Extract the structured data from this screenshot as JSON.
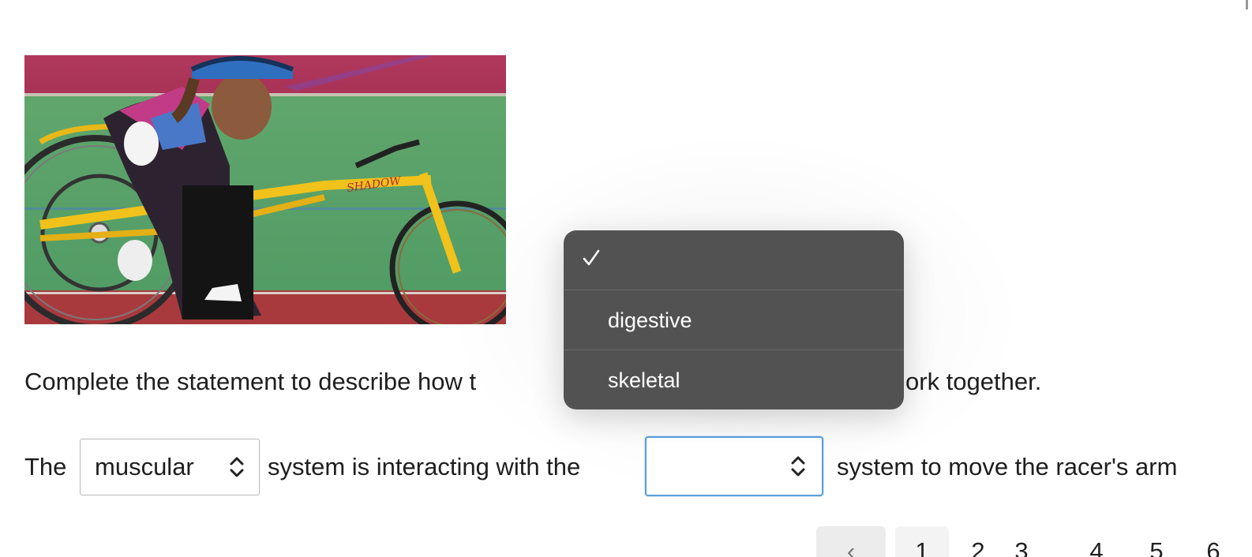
{
  "question": {
    "prompt_start": "Complete the statement to describe how t",
    "prompt_end": "ork together.",
    "statement": {
      "word_the": "The",
      "middle": "system is interacting with the",
      "end": "system to move the racer's arm"
    }
  },
  "select_1": {
    "value": "muscular",
    "icon": "up-down-chevron-icon"
  },
  "select_2": {
    "value": "",
    "icon": "up-down-chevron-icon",
    "focused": true
  },
  "dropdown": {
    "options": [
      {
        "label": "",
        "checked": true
      },
      {
        "label": "digestive",
        "checked": false
      },
      {
        "label": "skeletal",
        "checked": false
      }
    ],
    "background": "#525252"
  },
  "pagination": {
    "prev_icon": "‹",
    "pages": [
      "1",
      "2",
      "3",
      "4",
      "5",
      "6"
    ]
  },
  "colors": {
    "focus_border": "#5aa0dc",
    "text": "#1e1e1e"
  },
  "photo": {
    "frame_text": "SHADOW"
  }
}
